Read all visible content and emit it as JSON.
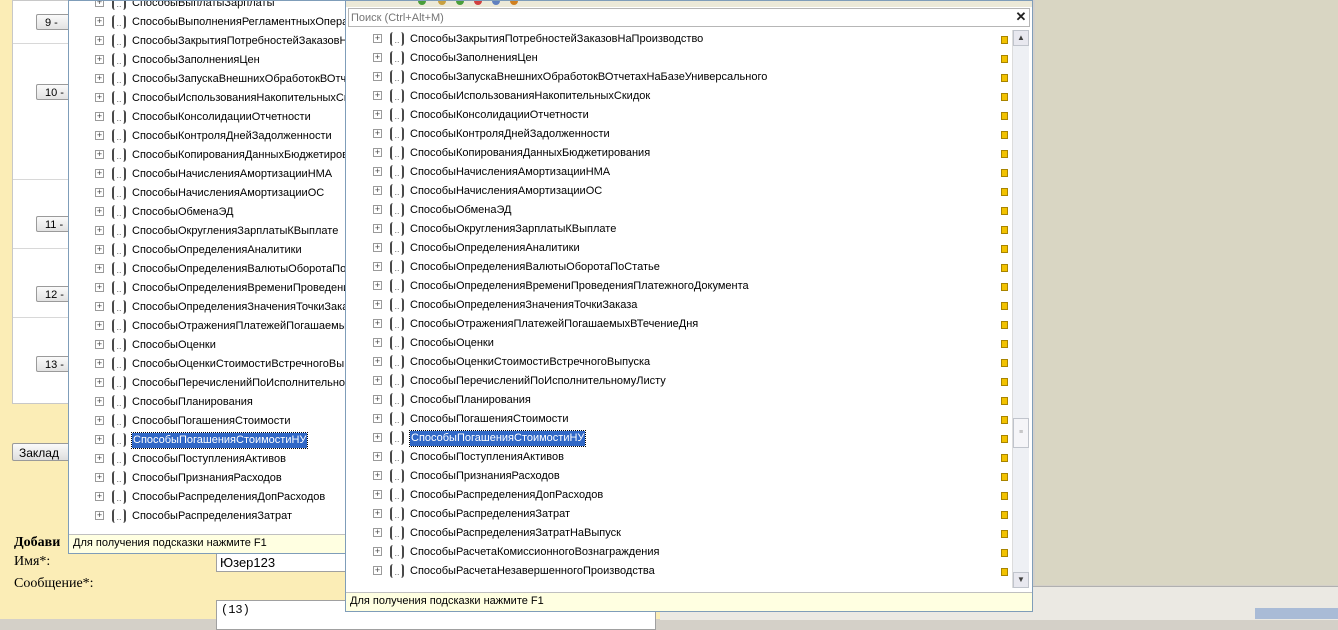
{
  "webpage": {
    "row_numbers": [
      "9 -",
      "10 -",
      "11 -",
      "12 -",
      "13 -"
    ],
    "tab_button_label": "Заклад",
    "form_title": "Добави",
    "name_label": "Имя*:",
    "message_label": "Сообщение*:",
    "name_value": "Юзер123",
    "message_value": "(13)"
  },
  "back_popup": {
    "items": [
      {
        "label": "СпособыВыплатыЗарплаты"
      },
      {
        "label": "СпособыВыполненияРегламентныхОпера"
      },
      {
        "label": "СпособыЗакрытияПотребностейЗаказовН"
      },
      {
        "label": "СпособыЗаполненияЦен"
      },
      {
        "label": "СпособыЗапускаВнешнихОбработокВОтч"
      },
      {
        "label": "СпособыИспользованияНакопительныхСк"
      },
      {
        "label": "СпособыКонсолидацииОтчетности"
      },
      {
        "label": "СпособыКонтроляДнейЗадолженности"
      },
      {
        "label": "СпособыКопированияДанныхБюджетиров"
      },
      {
        "label": "СпособыНачисленияАмортизацииНМА"
      },
      {
        "label": "СпособыНачисленияАмортизацииОС"
      },
      {
        "label": "СпособыОбменаЭД"
      },
      {
        "label": "СпособыОкругленияЗарплатыКВыплате"
      },
      {
        "label": "СпособыОпределенияАналитики"
      },
      {
        "label": "СпособыОпределенияВалютыОборотаПоС"
      },
      {
        "label": "СпособыОпределенияВремениПроведени"
      },
      {
        "label": "СпособыОпределенияЗначенияТочкиЗака"
      },
      {
        "label": "СпособыОтраженияПлатежейПогашаемы"
      },
      {
        "label": "СпособыОценки"
      },
      {
        "label": "СпособыОценкиСтоимостиВстречногоВы"
      },
      {
        "label": "СпособыПеречисленийПоИсполнительно"
      },
      {
        "label": "СпособыПланирования"
      },
      {
        "label": "СпособыПогашенияСтоимости"
      },
      {
        "label": "СпособыПогашенияСтоимостиНУ",
        "selected": true
      },
      {
        "label": "СпособыПоступленияАктивов"
      },
      {
        "label": "СпособыПризнанияРасходов"
      },
      {
        "label": "СпособыРаспределенияДопРасходов"
      },
      {
        "label": "СпособыРаспределенияЗатрат"
      }
    ],
    "hint": "Для получения подсказки нажмите F1"
  },
  "front_popup": {
    "search_placeholder": "Поиск (Ctrl+Alt+M)",
    "close_glyph": "✕",
    "items": [
      {
        "label": "СпособыЗакрытияПотребностейЗаказовНаПроизводство"
      },
      {
        "label": "СпособыЗаполненияЦен"
      },
      {
        "label": "СпособыЗапускаВнешнихОбработокВОтчетахНаБазеУниверсального"
      },
      {
        "label": "СпособыИспользованияНакопительныхСкидок"
      },
      {
        "label": "СпособыКонсолидацииОтчетности"
      },
      {
        "label": "СпособыКонтроляДнейЗадолженности"
      },
      {
        "label": "СпособыКопированияДанныхБюджетирования"
      },
      {
        "label": "СпособыНачисленияАмортизацииНМА"
      },
      {
        "label": "СпособыНачисленияАмортизацииОС"
      },
      {
        "label": "СпособыОбменаЭД"
      },
      {
        "label": "СпособыОкругленияЗарплатыКВыплате"
      },
      {
        "label": "СпособыОпределенияАналитики"
      },
      {
        "label": "СпособыОпределенияВалютыОборотаПоСтатье"
      },
      {
        "label": "СпособыОпределенияВремениПроведенияПлатежногоДокумента"
      },
      {
        "label": "СпособыОпределенияЗначенияТочкиЗаказа"
      },
      {
        "label": "СпособыОтраженияПлатежейПогашаемыхВТечениеДня"
      },
      {
        "label": "СпособыОценки"
      },
      {
        "label": "СпособыОценкиСтоимостиВстречногоВыпуска"
      },
      {
        "label": "СпособыПеречисленийПоИсполнительномуЛисту"
      },
      {
        "label": "СпособыПланирования"
      },
      {
        "label": "СпособыПогашенияСтоимости"
      },
      {
        "label": "СпособыПогашенияСтоимостиНУ",
        "selected": true
      },
      {
        "label": "СпособыПоступленияАктивов"
      },
      {
        "label": "СпособыПризнанияРасходов"
      },
      {
        "label": "СпособыРаспределенияДопРасходов"
      },
      {
        "label": "СпособыРаспределенияЗатрат"
      },
      {
        "label": "СпособыРаспределенияЗатратНаВыпуск"
      },
      {
        "label": "СпособыРасчетаКомиссионногоВознаграждения"
      },
      {
        "label": "СпособыРасчетаНезавершенногоПроизводства"
      }
    ],
    "scroll_up_glyph": "▲",
    "scroll_down_glyph": "▼",
    "hint": "Для получения подсказки нажмите F1"
  },
  "icons": {
    "expander": "plus-expander-icon",
    "object": "object-group-icon",
    "lock": "lock-icon"
  },
  "colors": {
    "selection": "#3168c6",
    "page_background": "#fbedb6",
    "hint_background": "#ffffe1"
  }
}
